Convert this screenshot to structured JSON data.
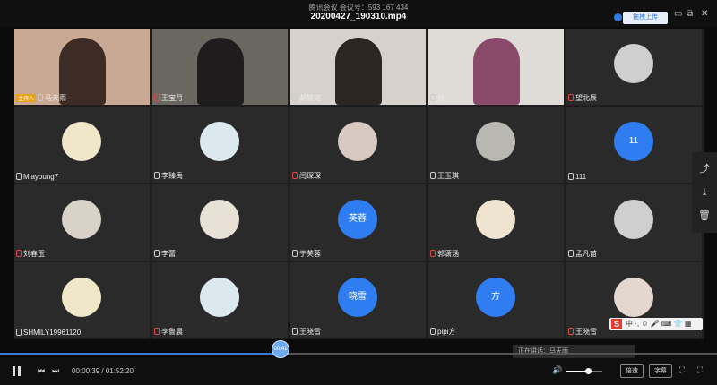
{
  "topbar": {
    "meeting_info": "腾讯会议 会议号：593 167 434",
    "file_title": "20200427_190310.mp4",
    "upload_label": "拖拽上传",
    "minimize": "▭",
    "maximize": "⧉",
    "close": "✕"
  },
  "colors": {
    "accent": "#2d7be0",
    "host_tag": "#e8a21a",
    "avatar_blue": "#2f7df0",
    "tile_bg": "#2a2a2a"
  },
  "host_label": "主持人",
  "participants": [
    {
      "name": "马天雨",
      "host": true,
      "avatar_text": ""
    },
    {
      "name": "王宝月",
      "avatar_text": ""
    },
    {
      "name": "胡铭铭",
      "avatar_text": ""
    },
    {
      "name": "孙",
      "avatar_text": ""
    },
    {
      "name": "望北辰",
      "avatar_text": ""
    },
    {
      "name": "Miayoung7",
      "avatar_text": ""
    },
    {
      "name": "李臻禹",
      "avatar_text": ""
    },
    {
      "name": "闫琛琛",
      "avatar_text": ""
    },
    {
      "name": "王玉琪",
      "avatar_text": ""
    },
    {
      "name": "111",
      "avatar_text": "11"
    },
    {
      "name": "刘春玉",
      "avatar_text": ""
    },
    {
      "name": "李蕾",
      "avatar_text": ""
    },
    {
      "name": "于芙蓉",
      "avatar_text": "芙蓉"
    },
    {
      "name": "郭潇涵",
      "avatar_text": ""
    },
    {
      "name": "孟凡苗",
      "avatar_text": ""
    },
    {
      "name": "SHMILY19961120",
      "avatar_text": ""
    },
    {
      "name": "李鲁晨",
      "avatar_text": ""
    },
    {
      "name": "王晓雪",
      "avatar_text": "晓雪"
    },
    {
      "name": "pipi方",
      "avatar_text": "方"
    },
    {
      "name": "王晓雪",
      "avatar_text": ""
    }
  ],
  "speaking_label": "正在讲话：马天雨",
  "side_icons": [
    "share-icon",
    "download-icon",
    "trash-icon"
  ],
  "ime_text": "中 ·, ☺ 🎤 ⌨ 👕 ▦",
  "player": {
    "current_time": "00:00:39",
    "total_time": "01:52:20",
    "progress": 0.39,
    "volume": 0.6,
    "scrubber_label": "00:41",
    "speed_label": "倍速",
    "subtitle_label": "字幕",
    "fullscreen_icon": "⛶",
    "more_icon": "⛶"
  }
}
